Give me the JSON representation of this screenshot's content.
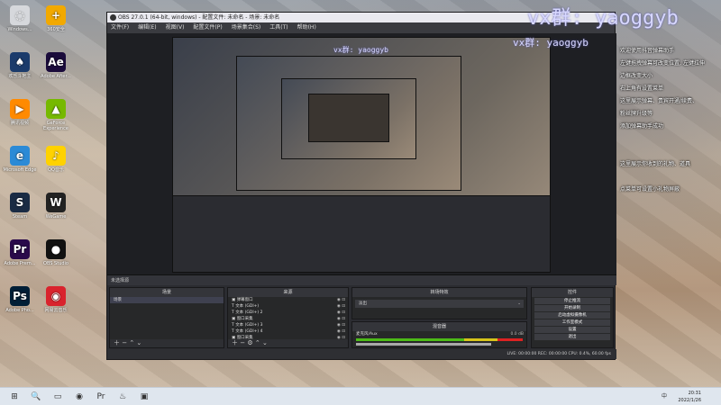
{
  "desktop": {
    "icons": [
      {
        "label": "Windows...",
        "color": "#d6d8dc",
        "glyph": "◌"
      },
      {
        "label": "欢乐斗地主",
        "color": "#1b3b6b",
        "glyph": "♠"
      },
      {
        "label": "腾讯视频",
        "color": "#ff8a00",
        "glyph": "▶"
      },
      {
        "label": "Microsoft Edge",
        "color": "#2b8ad6",
        "glyph": "e"
      },
      {
        "label": "Steam",
        "color": "#1a2b44",
        "glyph": "S"
      },
      {
        "label": "Adobe Prem...",
        "color": "#2a0a4a",
        "glyph": "Pr"
      },
      {
        "label": "Adobe Pho...",
        "color": "#001e36",
        "glyph": "Ps"
      },
      {
        "label": "360安全",
        "color": "#f2a900",
        "glyph": "+"
      },
      {
        "label": "Adobe After...",
        "color": "#1a0b3b",
        "glyph": "Ae"
      },
      {
        "label": "GeForce Experience",
        "color": "#76b900",
        "glyph": "▲"
      },
      {
        "label": "QQ音乐",
        "color": "#ffd200",
        "glyph": "♪"
      },
      {
        "label": "WeGame",
        "color": "#222",
        "glyph": "W"
      },
      {
        "label": "OBS Studio",
        "color": "#111",
        "glyph": "●"
      },
      {
        "label": "网易云音乐",
        "color": "#d9232d",
        "glyph": "◉"
      }
    ]
  },
  "obs": {
    "title": "OBS 27.0.1 (64-bit, windows) - 配置文件: 未命名 - 场景: 未命名",
    "menu": [
      "文件(F)",
      "编辑(E)",
      "视图(V)",
      "配置文件(P)",
      "场景集合(S)",
      "工具(T)",
      "帮助(H)"
    ],
    "watermark": "vx群: yaoggyb",
    "context_bar": "未选择源",
    "panels": {
      "scenes": {
        "title": "场景",
        "items": [
          "场景"
        ]
      },
      "sources": {
        "title": "来源",
        "items": [
          {
            "label": "弹幕窗口",
            "type": "▣"
          },
          {
            "label": "文本 (GDI+)",
            "type": "T"
          },
          {
            "label": "文本 (GDI+) 2",
            "type": "T"
          },
          {
            "label": "窗口采集",
            "type": "▣"
          },
          {
            "label": "文本 (GDI+) 3",
            "type": "T"
          },
          {
            "label": "文本 (GDI+) 4",
            "type": "T"
          },
          {
            "label": "窗口采集",
            "type": "▣"
          }
        ]
      },
      "transitions": {
        "title": "转场特效",
        "value": "淡出"
      },
      "mixer": {
        "title": "混音器",
        "track": "麦克风/Aux",
        "level": "0.0 dB"
      },
      "controls": {
        "title": "控件",
        "buttons": [
          "停止推流",
          "开始录制",
          "启动虚拟摄像机",
          "工作室模式",
          "设置",
          "退出"
        ]
      }
    },
    "status": "LIVE: 00:00:00   REC: 00:00:00   CPU: 0.4%, 60.00 fps"
  },
  "notes": [
    "欢迎使用抖音弹幕助手",
    "左键拖拽弹幕可改变位置, 左键拉伸",
    "边框改变大小",
    "右上角有设置菜单",
    "这里展示弹幕、贵宾开通/续费、",
    "粉丝牌升级等",
    "添加弹幕助手成功",
    "",
    "",
    "这里展示你收到的礼物、道具",
    "",
    "点菜单可设置小礼物屏蔽"
  ],
  "taskbar": {
    "apps": [
      "⊞",
      "🔍",
      "▭",
      "◉",
      "Pr",
      "♨",
      "▣"
    ],
    "time": "20:31",
    "date": "2022/1/26",
    "lang": "中"
  }
}
